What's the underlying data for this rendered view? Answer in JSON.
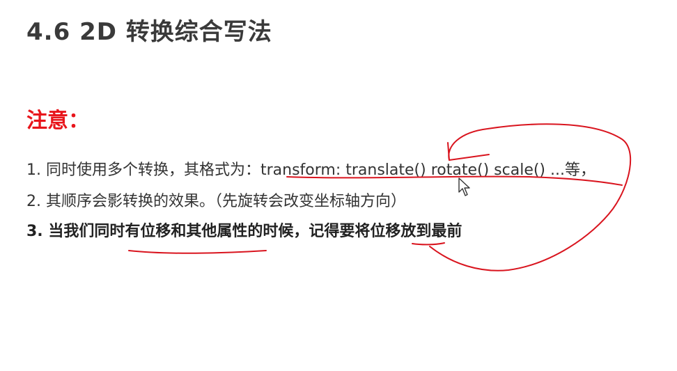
{
  "slide": {
    "title": "4.6 2D 转换综合写法",
    "note_heading": "注意：",
    "lines": [
      "1. 同时使用多个转换，其格式为：transform: translate() rotate() scale() ...等，",
      "2. 其顺序会影转换的效果。（先旋转会改变坐标轴方向）",
      "3. 当我们同时有位移和其他属性的时候，记得要将位移放到最前"
    ]
  },
  "colors": {
    "heading_red": "#e8151b",
    "annotation_red": "#d9141e",
    "text": "#333333"
  },
  "icons": {
    "cursor": "arrow-pointer-icon"
  }
}
